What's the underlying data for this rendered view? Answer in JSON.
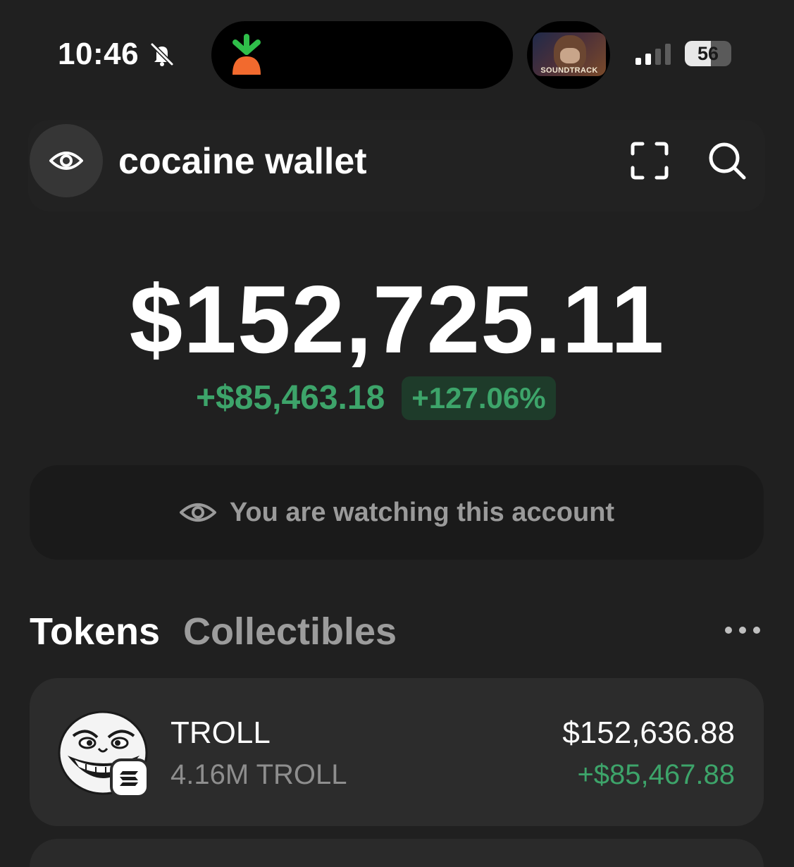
{
  "status_bar": {
    "time": "10:46",
    "battery_level": "56",
    "battery_fraction": 0.56,
    "now_playing_label": "SOUNDTRACK",
    "icons": [
      "bell-slash-icon",
      "carrot-app-icon",
      "cellular-signal-icon",
      "battery-icon"
    ]
  },
  "header": {
    "wallet_name": "cocaine wallet",
    "icons": [
      "eye-icon",
      "scan-icon",
      "search-icon"
    ]
  },
  "balance": {
    "total": "$152,725.11",
    "change_amount": "+$85,463.18",
    "change_percent": "+127.06%"
  },
  "watching": {
    "text": "You are watching this account",
    "icon": "eye-icon"
  },
  "tabs": [
    {
      "label": "Tokens",
      "active": true
    },
    {
      "label": "Collectibles",
      "active": false
    }
  ],
  "tokens": [
    {
      "name": "TROLL",
      "amount": "4.16M TROLL",
      "value": "$152,636.88",
      "change": "+$85,467.88",
      "icon": "troll-face-avatar",
      "chain_icon": "solana-icon"
    }
  ],
  "colors": {
    "background": "#202020",
    "positive": "#3da46a",
    "positive_bg": "#1e3b2a",
    "card": "#2c2c2c",
    "muted_text": "#9a9a9a"
  }
}
